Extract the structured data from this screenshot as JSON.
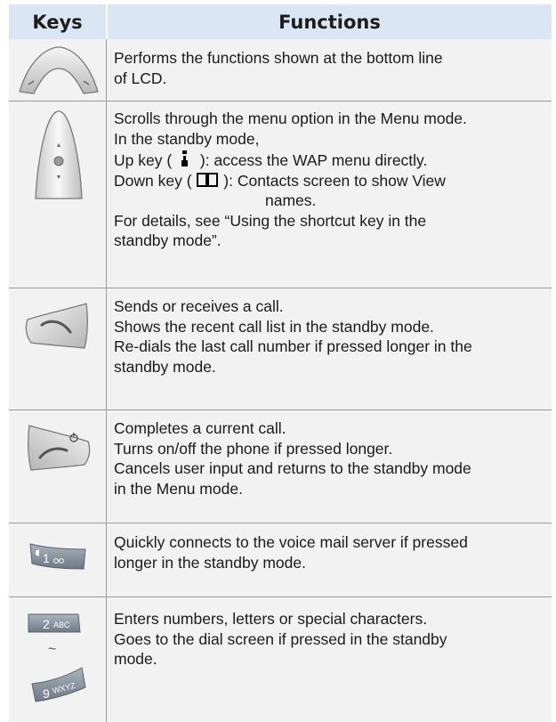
{
  "header": {
    "keys": "Keys",
    "functions": "Functions"
  },
  "rows": [
    {
      "key_icon": "soft-keys-icon",
      "lines": [
        "Performs the functions shown at the bottom line",
        "of LCD."
      ]
    },
    {
      "key_icon": "navigation-key-icon",
      "lines": [
        "Scrolls through the menu option in the Menu mode.",
        "In the standby mode,",
        "Up key (",
        "): access the WAP menu directly.",
        "Down key (",
        "): Contacts screen to show View",
        "names.",
        "For details, see “Using the shortcut key in the",
        "standby mode”."
      ],
      "inline_icons": [
        "wap-icon",
        "phonebook-icon"
      ]
    },
    {
      "key_icon": "send-key-icon",
      "lines": [
        "Sends or receives a call.",
        "Shows the recent call list in the standby mode.",
        "Re-dials the last call number if pressed longer in the",
        "standby mode."
      ]
    },
    {
      "key_icon": "end-key-icon",
      "lines": [
        "Completes a current call.",
        "Turns on/off the phone if pressed longer.",
        "Cancels user input and returns to the standby mode",
        "in the Menu mode."
      ]
    },
    {
      "key_icon": "voicemail-key-icon",
      "key_label": "1",
      "lines": [
        "Quickly connects to the voice mail server if pressed",
        "longer in the standby mode."
      ]
    },
    {
      "key_icon": "number-keys-icon",
      "key_labels": [
        "2",
        "ABC",
        "~",
        "9",
        "WXYZ"
      ],
      "lines": [
        "Enters numbers, letters or special characters.",
        "Goes to the dial screen if pressed in the standby",
        "mode."
      ]
    }
  ]
}
